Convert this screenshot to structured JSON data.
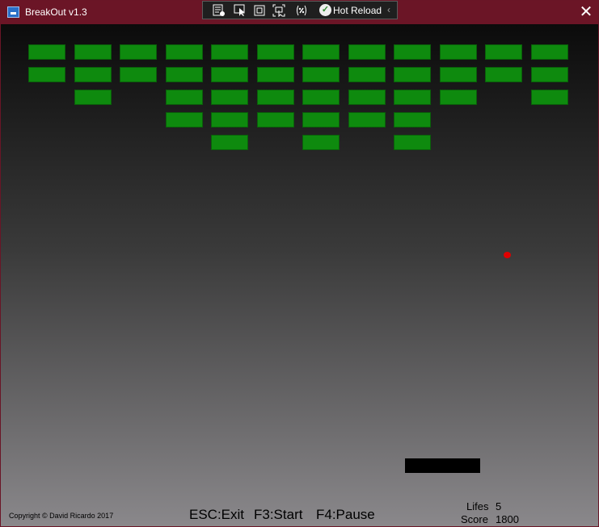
{
  "window": {
    "title": "BreakOut v1.3",
    "close_glyph": "✕",
    "titlebar_color": "#6b1526"
  },
  "devbar": {
    "hot_reload_label": "Hot Reload",
    "collapse_glyph": "‹",
    "icons": [
      "live-visual-tree-icon",
      "select-element-icon",
      "display-layout-adorners-icon",
      "track-focus-icon",
      "binding-failures-icon",
      "hot-reload-check-icon"
    ]
  },
  "game": {
    "brick_color": "#0e8a0e",
    "ball_color": "#e00000",
    "paddle_color": "#000000",
    "grid": {
      "columns": 12,
      "rows": 5
    },
    "bricks_present": [
      [
        1,
        1,
        1,
        1,
        1,
        1,
        1,
        1,
        1,
        1,
        1,
        1
      ],
      [
        1,
        1,
        1,
        1,
        1,
        1,
        1,
        1,
        1,
        1,
        1,
        1
      ],
      [
        0,
        1,
        0,
        1,
        1,
        1,
        1,
        1,
        1,
        1,
        0,
        1
      ],
      [
        0,
        0,
        0,
        1,
        1,
        1,
        1,
        1,
        1,
        0,
        0,
        0
      ],
      [
        0,
        0,
        0,
        0,
        1,
        0,
        1,
        0,
        1,
        0,
        0,
        0
      ]
    ],
    "copyright": "Copyright © David Ricardo 2017",
    "controls": {
      "exit": "ESC:Exit",
      "start": "F3:Start",
      "pause": "F4:Pause"
    },
    "stats": {
      "lives_label": "Lifes",
      "lives_value": "5",
      "score_label": "Score",
      "score_value": "1800"
    }
  }
}
